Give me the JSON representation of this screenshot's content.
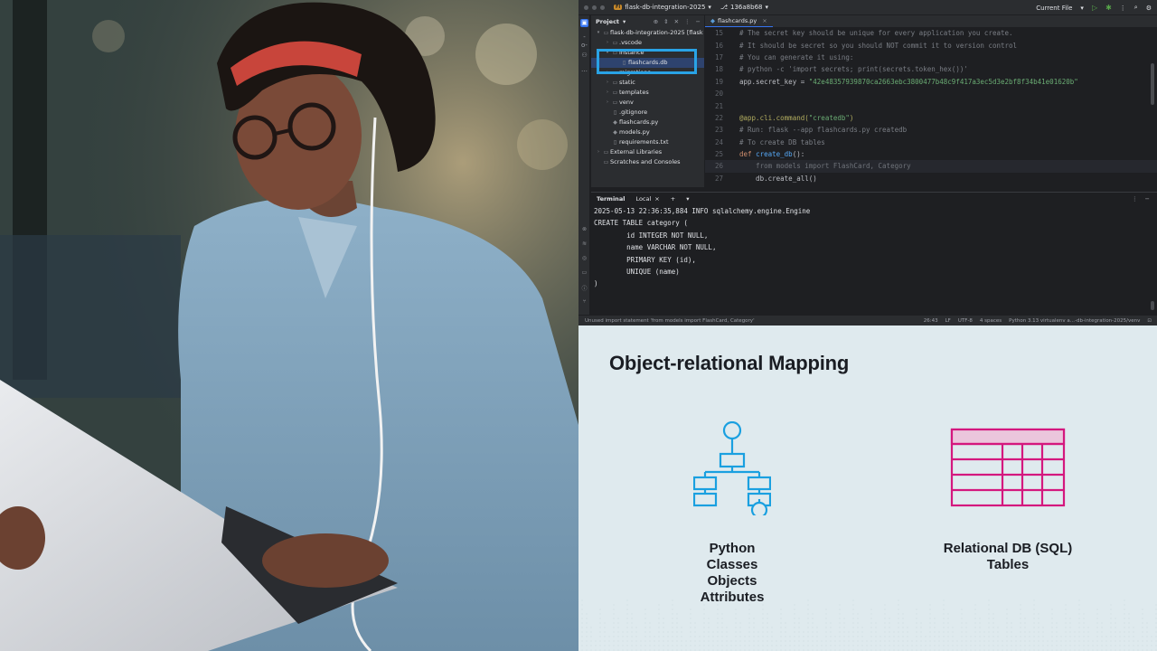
{
  "ide": {
    "titlebar": {
      "project_badge": "FI",
      "project_name": "flask-db-integration-2025",
      "branch": "136a8b68",
      "run_config": "Current File"
    },
    "project_panel": {
      "title": "Project",
      "tree": [
        {
          "label": "flask-db-integration-2025 [flask",
          "type": "folder",
          "depth": 0,
          "expanded": true
        },
        {
          "label": ".vscode",
          "type": "folder",
          "depth": 1,
          "expanded": false
        },
        {
          "label": "instance",
          "type": "folder",
          "depth": 1,
          "expanded": true
        },
        {
          "label": "flashcards.db",
          "type": "file",
          "depth": 2,
          "selected": true
        },
        {
          "label": "migrations",
          "type": "folder",
          "depth": 1,
          "expanded": false
        },
        {
          "label": "static",
          "type": "folder",
          "depth": 1,
          "expanded": false
        },
        {
          "label": "templates",
          "type": "folder",
          "depth": 1,
          "expanded": false
        },
        {
          "label": "venv",
          "type": "folder",
          "depth": 1,
          "expanded": false
        },
        {
          "label": ".gitignore",
          "type": "file",
          "depth": 1
        },
        {
          "label": "flashcards.py",
          "type": "python",
          "depth": 1
        },
        {
          "label": "models.py",
          "type": "python",
          "depth": 1
        },
        {
          "label": "requirements.txt",
          "type": "file",
          "depth": 1
        },
        {
          "label": "External Libraries",
          "type": "folder",
          "depth": 0,
          "expanded": false
        },
        {
          "label": "Scratches and Consoles",
          "type": "folder",
          "depth": 0
        }
      ]
    },
    "editor_tab": "flashcards.py",
    "inspections": {
      "warnings": "2",
      "weak": "2"
    },
    "code": [
      {
        "n": "15",
        "text": "# The secret key should be unique for every application you create.",
        "kind": "cm"
      },
      {
        "n": "16",
        "text": "# It should be secret so you should NOT commit it to version control",
        "kind": "cm"
      },
      {
        "n": "17",
        "text": "# You can generate it using:",
        "kind": "cm"
      },
      {
        "n": "18",
        "text": "# python -c 'import secrets; print(secrets.token_hex())'",
        "kind": "cm"
      },
      {
        "n": "19",
        "text": "app.secret_key = ",
        "str": "\"42e48357939870ca2663ebc3800477b48c9f417a3ec5d3e2bf8f34b41e01620b\"",
        "kind": "assign"
      },
      {
        "n": "20",
        "text": "",
        "kind": "plain"
      },
      {
        "n": "21",
        "text": "",
        "kind": "plain"
      },
      {
        "n": "22",
        "text": "@app.cli.command(",
        "str": "\"createdb\"",
        "tail": ")",
        "kind": "dec"
      },
      {
        "n": "23",
        "text": "# Run: flask --app flashcards.py createdb",
        "kind": "cm"
      },
      {
        "n": "24",
        "text": "# To create DB tables",
        "kind": "cm"
      },
      {
        "n": "25",
        "kw": "def ",
        "fn": "create_db",
        "text": "():",
        "kind": "def"
      },
      {
        "n": "26",
        "text": "    from models import FlashCard, Category",
        "kind": "dimline",
        "current": true
      },
      {
        "n": "27",
        "text": "    db.create_all()",
        "kind": "plain"
      }
    ],
    "terminal": {
      "tab_active": "Terminal",
      "tab_local": "Local",
      "lines": [
        "2025-05-13 22:36:35,884 INFO sqlalchemy.engine.Engine",
        "CREATE TABLE category (",
        "        id INTEGER NOT NULL,",
        "        name VARCHAR NOT NULL,",
        "        PRIMARY KEY (id),",
        "        UNIQUE (name)",
        ")"
      ]
    },
    "statusbar": {
      "message": "Unused import statement 'from models import FlashCard, Category'",
      "position": "26:43",
      "line_sep": "LF",
      "encoding": "UTF-8",
      "indent": "4 spaces",
      "interpreter": "Python 3.13 virtualenv a...-db-integration-2025/venv"
    }
  },
  "orm": {
    "title": "Object-relational Mapping",
    "left_label": [
      "Python",
      "Classes",
      "Objects",
      "Attributes"
    ],
    "right_label": [
      "Relational DB (SQL)",
      "Tables"
    ],
    "colors": {
      "classes_icon": "#1aa0e0",
      "tables_icon": "#d4187e",
      "background": "#dfeaee"
    }
  }
}
